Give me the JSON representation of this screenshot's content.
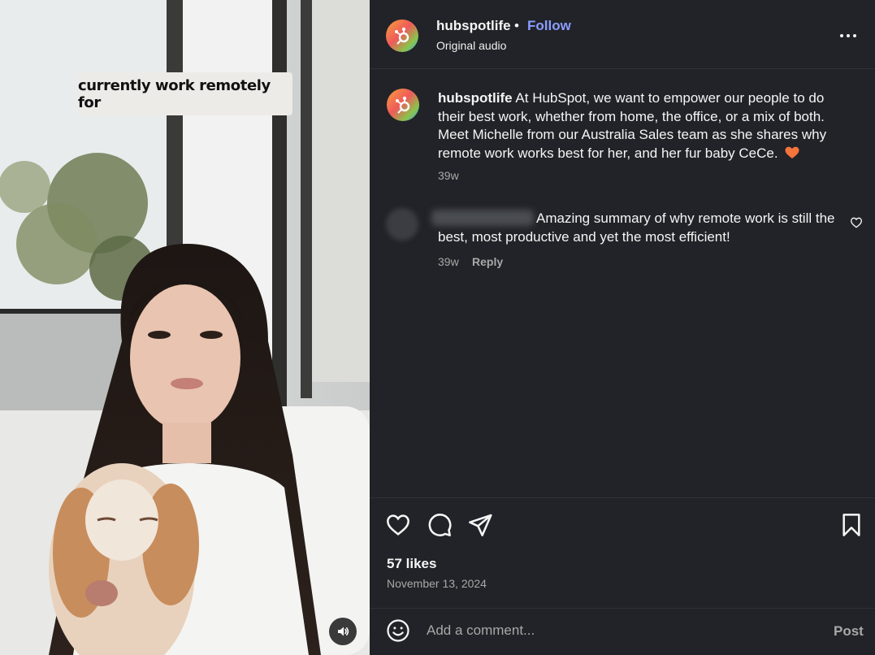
{
  "media": {
    "overlay_caption": "currently work remotely for",
    "mute_icon": "volume-icon"
  },
  "header": {
    "username": "hubspotlife",
    "separator": "•",
    "follow_label": "Follow",
    "audio_label": "Original audio",
    "more_icon": "more-horizontal-icon"
  },
  "caption": {
    "username": "hubspotlife",
    "text": "At HubSpot, we want to empower our people to do their best work, whether from home, the office, or a mix of both. Meet Michelle from our Australia Sales team as she shares why remote work works best for her, and her fur baby CeCe.",
    "emoji": "orange-heart-icon",
    "time": "39w"
  },
  "comments": [
    {
      "text": "Amazing summary of why remote work is still the best, most productive and yet the most efficient!",
      "time": "39w",
      "reply_label": "Reply"
    }
  ],
  "actions": {
    "like_icon": "heart-icon",
    "comment_icon": "comment-icon",
    "share_icon": "send-icon",
    "save_icon": "bookmark-icon"
  },
  "likes": "57 likes",
  "date": "November 13, 2024",
  "composer": {
    "placeholder": "Add a comment...",
    "post_label": "Post"
  },
  "colors": {
    "background": "#212328",
    "follow": "#8b9cff",
    "muted_text": "#a8a8a8",
    "heart_emoji": "#f4743b"
  }
}
